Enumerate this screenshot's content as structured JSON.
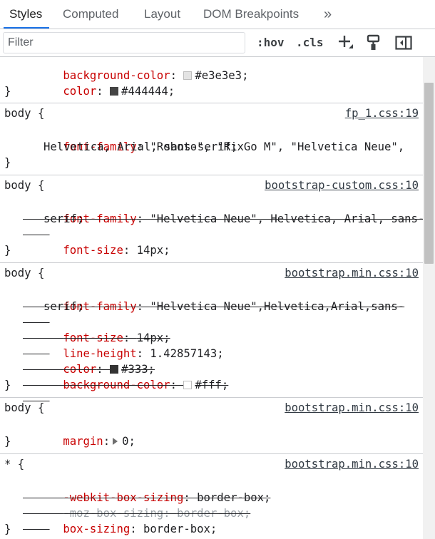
{
  "tabs": [
    {
      "label": "Styles"
    },
    {
      "label": "Computed"
    },
    {
      "label": "Layout"
    },
    {
      "label": "DOM Breakpoints"
    }
  ],
  "overflow_icon": "»",
  "toolbar": {
    "filter_placeholder": "Filter",
    "hov_label": ":hov",
    "cls_label": ".cls",
    "plus_label": "+"
  },
  "colors": {
    "tab_accent": "#1a73e8",
    "property": "#c80000"
  },
  "rules": [
    {
      "selector": "",
      "source": "",
      "declarations": [
        {
          "prop": "background-color",
          "value": "#e3e3e3",
          "swatch": "#e3e3e3"
        },
        {
          "prop": "color",
          "value": "#444444",
          "swatch": "#444444"
        }
      ],
      "close": "}"
    },
    {
      "selector": "body {",
      "source": "fp_1.css:19",
      "declarations": [
        {
          "prop": "font-family",
          "value": "\"Roboto\", \"RixGo M\", \"Helvetica Neue\",",
          "cont": "Helvetica, Arial, sans-serif;"
        }
      ],
      "close": "}"
    },
    {
      "selector": "body {",
      "source": "bootstrap-custom.css:10",
      "declarations": [
        {
          "prop": "font-family",
          "value": "\"Helvetica Neue\", Helvetica, Arial, sans-",
          "cont": "serif;"
        },
        {
          "prop": "font-size",
          "value": "14px;"
        }
      ],
      "close": "}"
    },
    {
      "selector": "body {",
      "source": "bootstrap.min.css:10",
      "declarations": [
        {
          "prop": "font-family",
          "value": "\"Helvetica Neue\",Helvetica,Arial,sans-",
          "cont": "serif;"
        },
        {
          "prop": "font-size",
          "value": "14px;"
        },
        {
          "prop": "line-height",
          "value": "1.42857143;"
        },
        {
          "prop": "color",
          "value": "#333;",
          "swatch": "#333333"
        },
        {
          "prop": "background-color",
          "value": "#fff;",
          "swatch": "#ffffff"
        }
      ],
      "close": "}"
    },
    {
      "selector": "body {",
      "source": "bootstrap.min.css:10",
      "declarations": [
        {
          "prop": "margin",
          "value": "0;"
        }
      ],
      "close": "}"
    },
    {
      "selector": "* {",
      "source": "bootstrap.min.css:10",
      "declarations": [
        {
          "prop": "-webkit-box-sizing",
          "value": "border-box;"
        },
        {
          "prop": "-moz-box-sizing",
          "value": "border-box;"
        },
        {
          "prop": "box-sizing",
          "value": "border-box;"
        }
      ],
      "close": "}"
    }
  ]
}
